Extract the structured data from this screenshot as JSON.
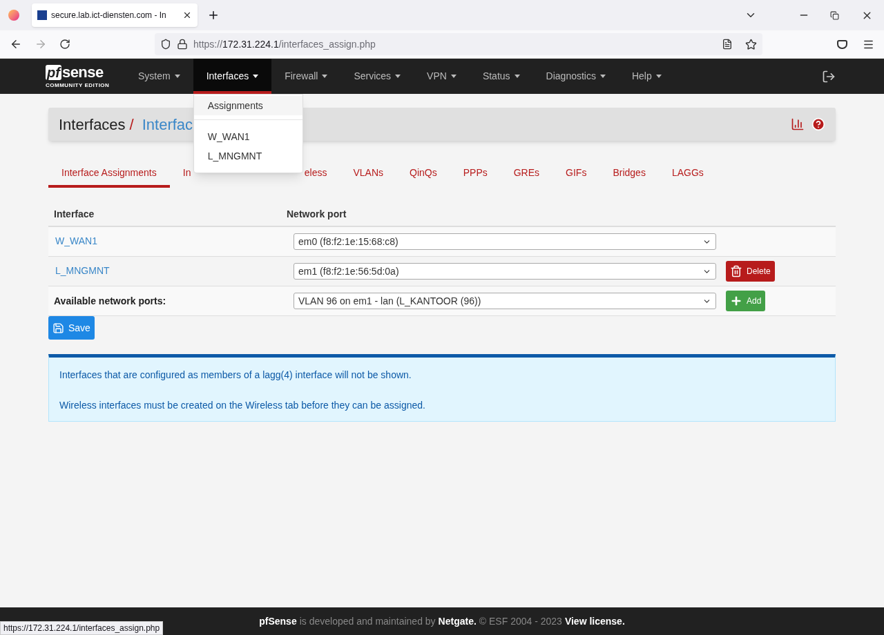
{
  "browser": {
    "tab_title": "secure.lab.ict-diensten.com - In",
    "url": {
      "scheme": "https://",
      "host": "172.31.224.1",
      "path": "/interfaces_assign.php"
    }
  },
  "navbar": {
    "logo": {
      "mark": "pf",
      "word": "sense",
      "edition": "COMMUNITY EDITION"
    },
    "items": [
      {
        "label": "System",
        "selected": false
      },
      {
        "label": "Interfaces",
        "selected": true
      },
      {
        "label": "Firewall",
        "selected": false
      },
      {
        "label": "Services",
        "selected": false
      },
      {
        "label": "VPN",
        "selected": false
      },
      {
        "label": "Status",
        "selected": false
      },
      {
        "label": "Diagnostics",
        "selected": false
      },
      {
        "label": "Help",
        "selected": false
      }
    ],
    "dropdown": {
      "sections": [
        [
          {
            "label": "Assignments",
            "highlighted": true
          }
        ],
        [
          {
            "label": "W_WAN1",
            "highlighted": false
          },
          {
            "label": "L_MNGMNT",
            "highlighted": false
          }
        ]
      ]
    }
  },
  "page_header": {
    "breadcrumb": [
      "Interfaces",
      "Interfac"
    ],
    "separator": "/"
  },
  "tabs": [
    {
      "label": "Interface Assignments",
      "selected": true
    },
    {
      "label": "In",
      "selected": false
    },
    {
      "label": "eless",
      "selected": false
    },
    {
      "label": "VLANs",
      "selected": false
    },
    {
      "label": "QinQs",
      "selected": false
    },
    {
      "label": "PPPs",
      "selected": false
    },
    {
      "label": "GREs",
      "selected": false
    },
    {
      "label": "GIFs",
      "selected": false
    },
    {
      "label": "Bridges",
      "selected": false
    },
    {
      "label": "LAGGs",
      "selected": false
    }
  ],
  "table": {
    "columns": [
      "Interface",
      "Network port"
    ],
    "rows": [
      {
        "kind": "assigned",
        "interface": "W_WAN1",
        "port": "em0 (f8:f2:1e:15:68:c8)"
      },
      {
        "kind": "assigned",
        "interface": "L_MNGMNT",
        "port": "em1 (f8:f2:1e:56:5d:0a)",
        "action": {
          "kind": "delete",
          "label": "Delete"
        }
      },
      {
        "kind": "available",
        "interface": "Available network ports:",
        "port": "VLAN 96 on em1 - lan (L_KANTOOR (96))",
        "action": {
          "kind": "add",
          "label": "Add"
        }
      }
    ]
  },
  "save_button": "Save",
  "info": [
    "Interfaces that are configured as members of a lagg(4) interface will not be shown.",
    "Wireless interfaces must be created on the Wireless tab before they can be assigned."
  ],
  "footer": [
    {
      "text": "pfSense",
      "strong": true
    },
    {
      "text": "is developed and maintained by",
      "strong": false
    },
    {
      "text": "Netgate.",
      "strong": true
    },
    {
      "text": "© ESF 2004 - 2023",
      "strong": false
    },
    {
      "text": "View license.",
      "strong": true
    }
  ],
  "status_url": "https://172.31.224.1/interfaces_assign.php"
}
